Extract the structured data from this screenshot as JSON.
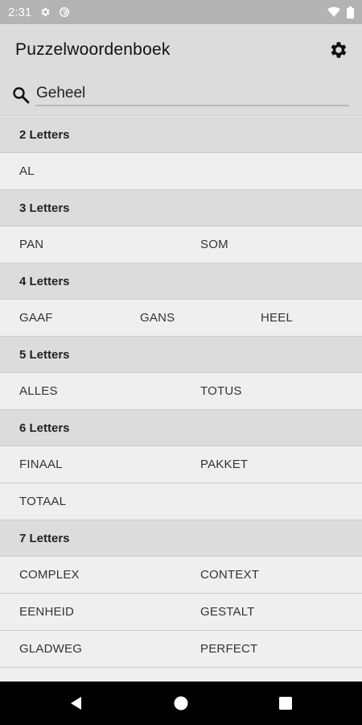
{
  "status_bar": {
    "time": "2:31"
  },
  "app_bar": {
    "title": "Puzzelwoordenboek"
  },
  "search": {
    "value": "Geheel"
  },
  "sections": [
    {
      "header": "2 Letters",
      "rows": [
        [
          "AL"
        ]
      ]
    },
    {
      "header": "3 Letters",
      "rows": [
        [
          "PAN",
          "SOM"
        ]
      ]
    },
    {
      "header": "4 Letters",
      "rows": [
        [
          "GAAF",
          "GANS",
          "HEEL"
        ]
      ]
    },
    {
      "header": "5 Letters",
      "rows": [
        [
          "ALLES",
          "TOTUS"
        ]
      ]
    },
    {
      "header": "6 Letters",
      "rows": [
        [
          "FINAAL",
          "PAKKET"
        ],
        [
          "TOTAAL"
        ]
      ]
    },
    {
      "header": "7 Letters",
      "rows": [
        [
          "COMPLEX",
          "CONTEXT"
        ],
        [
          "EENHEID",
          "GESTALT"
        ],
        [
          "GLADWEG",
          "PERFECT"
        ]
      ]
    }
  ],
  "colors": {
    "status_bar": "#b3b3b3",
    "app_bar": "#dcdcdc",
    "section_header": "#dcdcdc",
    "row_background": "#efefef",
    "nav_bar": "#000000"
  },
  "icons": [
    "gear-icon",
    "settings-status-icon",
    "sync-status-icon",
    "wifi-icon",
    "battery-icon",
    "search-icon",
    "back-icon",
    "home-icon",
    "recents-icon"
  ]
}
